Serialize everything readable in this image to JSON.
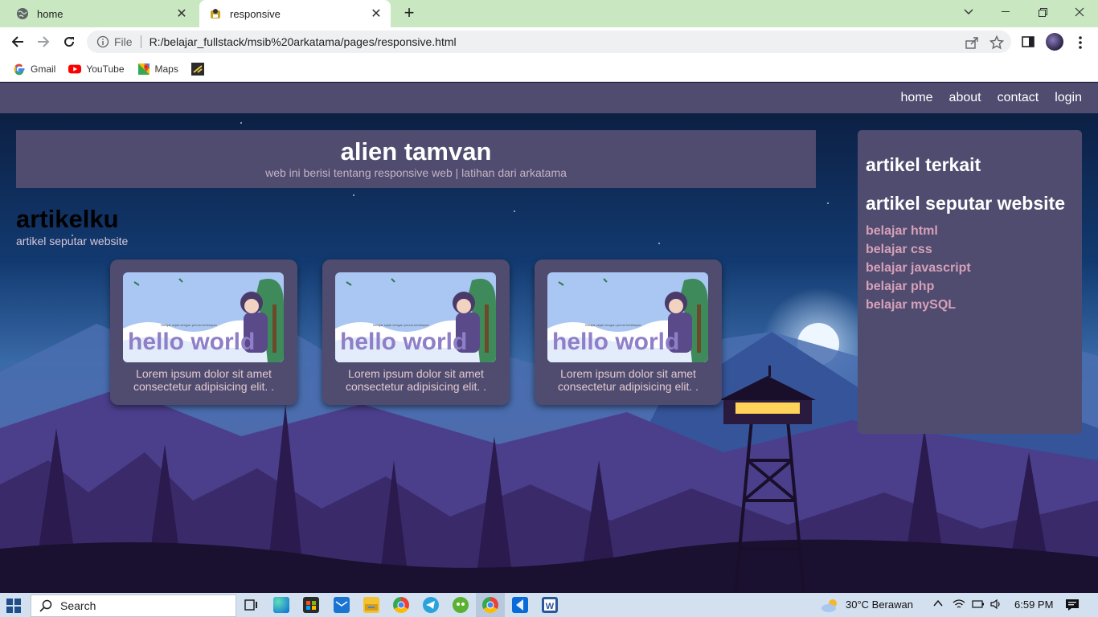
{
  "browser": {
    "tabs": [
      {
        "title": "home",
        "active": false
      },
      {
        "title": "responsive",
        "active": true
      }
    ],
    "address": {
      "scheme_label": "File",
      "url": "R:/belajar_fullstack/msib%20arkatama/pages/responsive.html"
    },
    "bookmarks": [
      {
        "label": "Gmail",
        "icon": "google-icon"
      },
      {
        "label": "YouTube",
        "icon": "youtube-icon"
      },
      {
        "label": "Maps",
        "icon": "maps-icon"
      }
    ]
  },
  "site": {
    "nav": [
      "home",
      "about",
      "contact",
      "login"
    ],
    "hero": {
      "title": "alien tamvan",
      "subtitle": "web ini berisi tentang responsive web | latihan dari arkatama"
    },
    "section": {
      "title": "artikelku",
      "subtitle": "artikel seputar website"
    },
    "cards": [
      {
        "caption": "hello world",
        "banner": "Belajar sejak dengan penuh-kehidupan",
        "desc": "Lorem ipsum dolor sit amet consectetur adipisicing elit. ."
      },
      {
        "caption": "hello world",
        "banner": "Belajar sejak dengan penuh-kehidupan",
        "desc": "Lorem ipsum dolor sit amet consectetur adipisicing elit. ."
      },
      {
        "caption": "hello world",
        "banner": "Belajar sejak dengan penuh-kehidupan",
        "desc": "Lorem ipsum dolor sit amet consectetur adipisicing elit. ."
      }
    ],
    "aside": {
      "heading1": "artikel terkait",
      "heading2": "artikel seputar website",
      "links": [
        "belajar html",
        "belajar css",
        "belajar javascript",
        "belajar php",
        "belajar mySQL"
      ]
    }
  },
  "taskbar": {
    "search_label": "Search",
    "weather": "30°C  Berawan",
    "time": "6:59 PM"
  },
  "colors": {
    "tabstrip": "#c9e8c1",
    "panel": "#4f4c70",
    "subtitle": "#c5b3c3",
    "link": "#d7a0b8"
  }
}
